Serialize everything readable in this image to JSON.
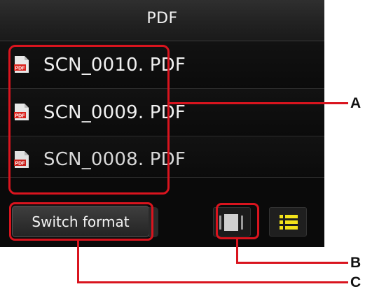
{
  "header": {
    "title": "PDF"
  },
  "files": [
    {
      "name": "SCN_0010. PDF",
      "icon": "pdf-file-icon"
    },
    {
      "name": "SCN_0009. PDF",
      "icon": "pdf-file-icon"
    },
    {
      "name": "SCN_0008. PDF",
      "icon": "pdf-file-icon"
    }
  ],
  "footer": {
    "switch_label": "Switch format",
    "thumbnail_view_icon": "thumbnail-view-icon",
    "list_view_icon": "list-view-icon"
  },
  "callouts": {
    "a": "A",
    "b": "B",
    "c": "C"
  },
  "colors": {
    "callout": "#d9141e",
    "list_icon_active": "#f3e31a",
    "pdf_red": "#d9221c"
  }
}
